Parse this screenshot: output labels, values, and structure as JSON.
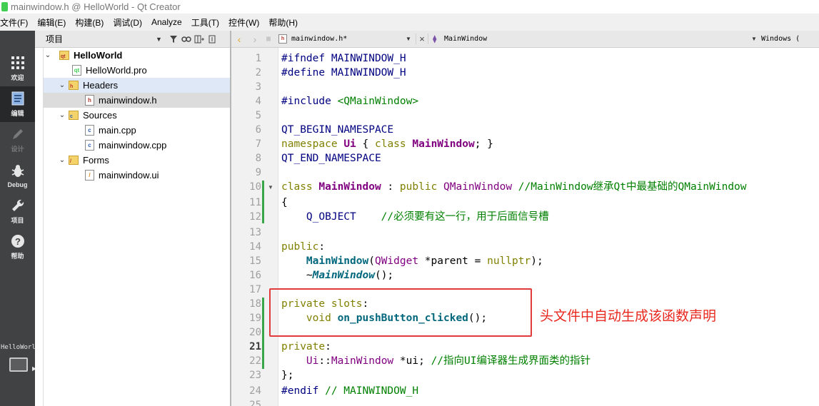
{
  "window": {
    "title": "mainwindow.h @ HelloWorld - Qt Creator",
    "app_icon": "qt-creator-icon"
  },
  "menubar": [
    "文件(F)",
    "编辑(E)",
    "构建(B)",
    "调试(D)",
    "Analyze",
    "工具(T)",
    "控件(W)",
    "帮助(H)"
  ],
  "modes": [
    {
      "label": "欢迎",
      "icon": "grid-icon"
    },
    {
      "label": "编辑",
      "icon": "document-icon"
    },
    {
      "label": "设计",
      "icon": "pencil-icon"
    },
    {
      "label": "Debug",
      "icon": "bug-icon"
    },
    {
      "label": "项目",
      "icon": "wrench-icon"
    },
    {
      "label": "帮助",
      "icon": "help-icon"
    }
  ],
  "kit": {
    "label": "HelloWorld"
  },
  "project_panel": {
    "title": "项目",
    "tree": [
      {
        "label": "HelloWorld",
        "kind": "project"
      },
      {
        "label": "HelloWorld.pro",
        "kind": "pro-file"
      },
      {
        "label": "Headers",
        "kind": "folder"
      },
      {
        "label": "mainwindow.h",
        "kind": "header"
      },
      {
        "label": "Sources",
        "kind": "folder"
      },
      {
        "label": "main.cpp",
        "kind": "source"
      },
      {
        "label": "mainwindow.cpp",
        "kind": "source"
      },
      {
        "label": "Forms",
        "kind": "folder"
      },
      {
        "label": "mainwindow.ui",
        "kind": "form"
      }
    ]
  },
  "editor": {
    "document": "mainwindow.h*",
    "symbol": "MainWindow",
    "encoding": "Windows (",
    "current_line": "21",
    "line_numbers": [
      "1",
      "2",
      "3",
      "4",
      "5",
      "6",
      "7",
      "8",
      "9",
      "10",
      "11",
      "12",
      "13",
      "14",
      "15",
      "16",
      "17",
      "18",
      "19",
      "20",
      "21",
      "22",
      "23",
      "24",
      "25"
    ]
  },
  "annotation": {
    "text": "头文件中自动生成该函数声明",
    "color": "#e8281e"
  }
}
